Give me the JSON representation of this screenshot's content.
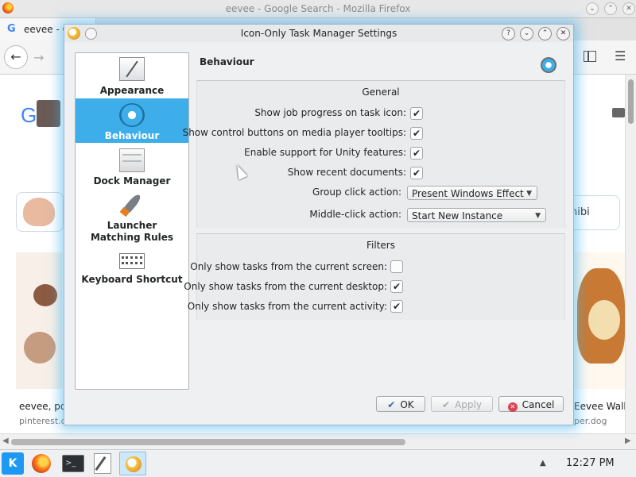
{
  "firefox": {
    "window_title": "eevee - Google Search - Mozilla Firefox",
    "tab_label": "eevee - G",
    "tab_icon": "G",
    "back_glyph": "←",
    "forward_glyph": "→",
    "menu_glyph": "☰",
    "search_chip_right": "hibi",
    "result_left_title": "eevee, pol",
    "result_left_source": "pinterest.c",
    "result_right_title": "Eevee Wallp",
    "result_right_source": "per.dog",
    "google_logo_letter": "G"
  },
  "dialog": {
    "title": "Icon-Only Task Manager Settings",
    "title_buttons": [
      "?",
      "⌄",
      "⌃",
      "✕"
    ],
    "sidebar": [
      {
        "label": "Appearance",
        "icon": "appearance-icon",
        "selected": false
      },
      {
        "label": "Behaviour",
        "icon": "behaviour-icon",
        "selected": true
      },
      {
        "label": "Dock Manager",
        "icon": "dock-manager-icon",
        "selected": false
      },
      {
        "label": "Launcher Matching Rules",
        "icon": "launcher-rocket-icon",
        "selected": false
      },
      {
        "label": "Keyboard Shortcut",
        "icon": "keyboard-icon",
        "selected": false
      }
    ],
    "page_title": "Behaviour",
    "general": {
      "title": "General",
      "rows": [
        {
          "label": "Show job progress on task icon:",
          "checked": true
        },
        {
          "label": "Show control buttons on media player tooltips:",
          "checked": true
        },
        {
          "label": "Enable support for Unity features:",
          "checked": true
        },
        {
          "label": "Show recent documents:",
          "checked": true
        }
      ],
      "group_click_label": "Group click action:",
      "group_click_value": "Present Windows Effect",
      "middle_click_label": "Middle-click action:",
      "middle_click_value": "Start New Instance"
    },
    "filters": {
      "title": "Filters",
      "rows": [
        {
          "label": "Only show tasks from the current screen:",
          "checked": false
        },
        {
          "label": "Only show tasks from the current desktop:",
          "checked": true
        },
        {
          "label": "Only show tasks from the current activity:",
          "checked": true
        }
      ]
    },
    "buttons": {
      "ok": "OK",
      "apply": "Apply",
      "cancel": "Cancel"
    },
    "check_glyph": "✔"
  },
  "taskbar": {
    "kde_label": "K",
    "terminal_label": ">_",
    "tray_arrow": "▲",
    "clock": "12:27 PM"
  },
  "colors": {
    "accent": "#3daee9",
    "dialog_bg": "#eff0f1",
    "cancel_red": "#da4453"
  }
}
